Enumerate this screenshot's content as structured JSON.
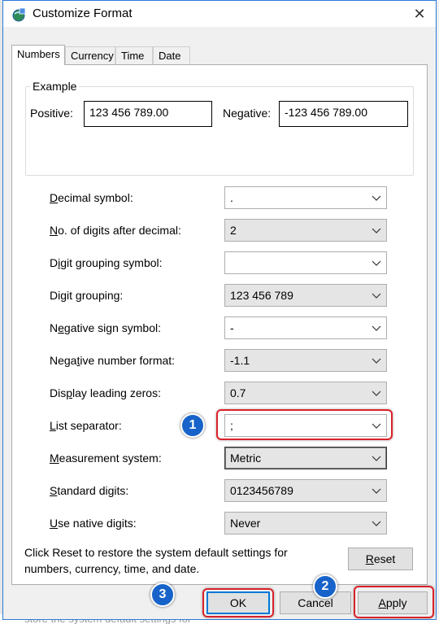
{
  "window": {
    "title": "Customize Format",
    "close_label": "✕"
  },
  "tabs": [
    "Numbers",
    "Currency",
    "Time",
    "Date"
  ],
  "example": {
    "legend": "Example",
    "positive_label": "Positive:",
    "positive_value": "123 456 789.00",
    "negative_label": "Negative:",
    "negative_value": "-123 456 789.00"
  },
  "rows": [
    {
      "label": "Decimal symbol:",
      "value": "."
    },
    {
      "label": "No. of digits after decimal:",
      "value": "2"
    },
    {
      "label": "Digit grouping symbol:",
      "value": ""
    },
    {
      "label": "Digit grouping:",
      "value": "123 456 789"
    },
    {
      "label": "Negative sign symbol:",
      "value": "-"
    },
    {
      "label": "Negative number format:",
      "value": "-1.1"
    },
    {
      "label": "Display leading zeros:",
      "value": "0.7"
    },
    {
      "label": "List separator:",
      "value": ";"
    },
    {
      "label": "Measurement system:",
      "value": "Metric"
    },
    {
      "label": "Standard digits:",
      "value": "0123456789"
    },
    {
      "label": "Use native digits:",
      "value": "Never"
    }
  ],
  "note": "Click Reset to restore the system default settings for numbers, currency, time, and date.",
  "buttons": {
    "reset": "Reset",
    "ok": "OK",
    "cancel": "Cancel",
    "apply": "Apply"
  },
  "badges": [
    "1",
    "2",
    "3"
  ],
  "background_text": "store the system default settings for",
  "colors": {
    "highlight": "#d9222a",
    "badge": "#1763c9",
    "focus_border": "#0078d7"
  }
}
